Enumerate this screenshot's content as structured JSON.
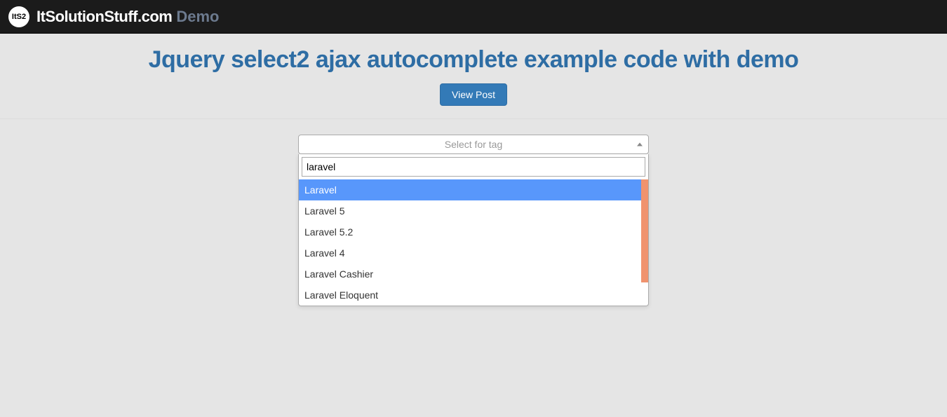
{
  "navbar": {
    "logo_text": "ItS2",
    "brand": "ItSolutionStuff.com",
    "demo_label": "Demo"
  },
  "header": {
    "title": "Jquery select2 ajax autocomplete example code with demo",
    "button_label": "View Post"
  },
  "select2": {
    "placeholder": "Select for tag",
    "search_value": "laravel",
    "options": [
      {
        "label": "Laravel",
        "highlighted": true
      },
      {
        "label": "Laravel 5",
        "highlighted": false
      },
      {
        "label": "Laravel 5.2",
        "highlighted": false
      },
      {
        "label": "Laravel 4",
        "highlighted": false
      },
      {
        "label": "Laravel Cashier",
        "highlighted": false
      },
      {
        "label": "Laravel Eloquent",
        "highlighted": false
      }
    ]
  }
}
